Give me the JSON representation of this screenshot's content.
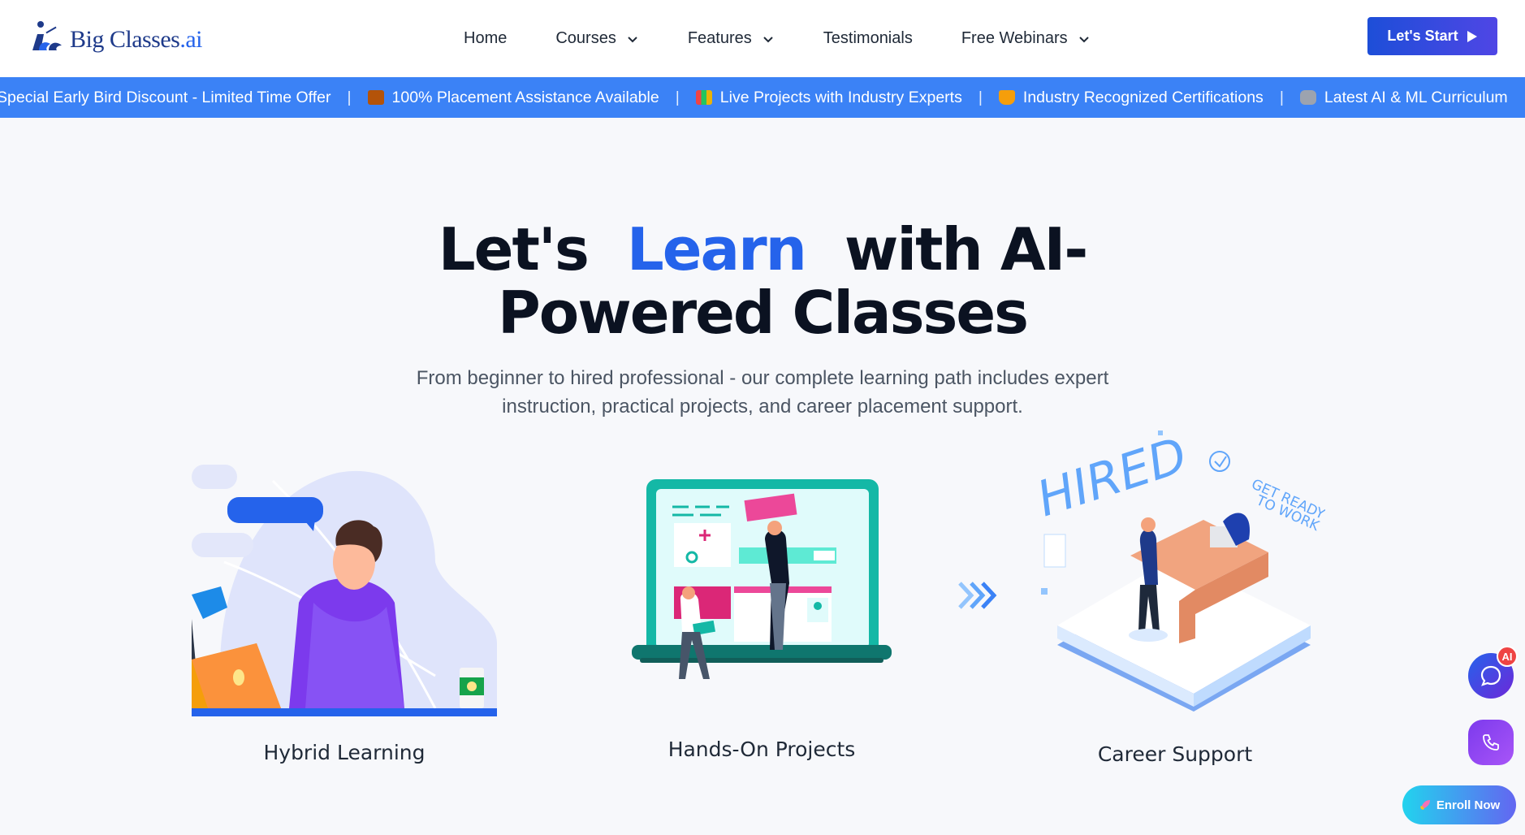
{
  "header": {
    "logo_text": "Big Classes",
    "logo_suffix": ".ai",
    "nav": [
      {
        "label": "Home",
        "dropdown": false
      },
      {
        "label": "Courses",
        "dropdown": true
      },
      {
        "label": "Features",
        "dropdown": true
      },
      {
        "label": "Testimonials",
        "dropdown": false
      },
      {
        "label": "Free Webinars",
        "dropdown": true
      }
    ],
    "cta_label": "Let's Start"
  },
  "ticker": {
    "items": [
      {
        "icon": "none",
        "text": "Special Early Bird Discount - Limited Time Offer"
      },
      {
        "icon": "briefcase-icon",
        "text": "100% Placement Assistance Available"
      },
      {
        "icon": "books-icon",
        "text": "Live Projects with Industry Experts"
      },
      {
        "icon": "trophy-icon",
        "text": "Industry Recognized Certifications"
      },
      {
        "icon": "robot-icon",
        "text": "Latest AI & ML Curriculum"
      }
    ],
    "separator": "|"
  },
  "hero": {
    "title_part1": "Let's",
    "title_accent": "Learn",
    "title_part2": "with AI-",
    "title_line2": "Powered Classes",
    "subtitle": "From beginner to hired professional - our complete learning path includes expert instruction, practical projects, and career placement support."
  },
  "features": [
    {
      "label": "Hybrid Learning"
    },
    {
      "label": "Hands-On Projects"
    },
    {
      "label": "Career Support"
    }
  ],
  "illustration_text": {
    "hired": "HIRED",
    "ready": "GET READY TO WORK"
  },
  "floating": {
    "ai_badge": "AI",
    "enroll_label": "Enroll Now"
  },
  "colors": {
    "accent": "#2563eb",
    "ticker_bg": "#3b82f6",
    "page_bg": "#f7f8fb"
  }
}
